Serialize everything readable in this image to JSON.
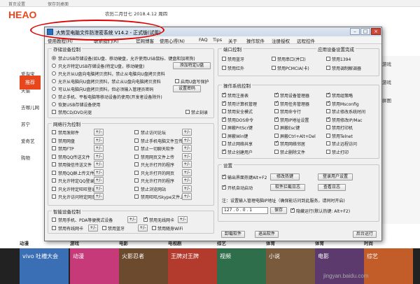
{
  "browser": {
    "tab_home": "首页设置",
    "tab_save": "保存到桌面",
    "logo": "HEAO",
    "date_line": "农历二月廿七  2018.4.12  周四",
    "left_items": [
      "爱淘宝",
      "天猫",
      "去哪儿网",
      "苏宁",
      "爱奇艺",
      "购物"
    ],
    "orange_badge": "推荐",
    "right_items": [
      "游戏",
      "游戏",
      "拼图"
    ],
    "bottom_cats": [
      "动漫",
      "游戏",
      "电影",
      "电视剧",
      "综艺",
      "体育",
      "体育",
      "时尚"
    ],
    "tiles": [
      "vivo 吐槽大会",
      "动漫",
      "火影忍者",
      "王牌对王牌",
      "视频",
      "小说",
      "电影",
      "综艺"
    ],
    "watermark": "jingyan.baidu.com"
  },
  "window": {
    "title": "大势至电脑文件防泄密系统 V14.2 - 正式版(试用)",
    "menu": [
      "使用教程(H)",
      "联系我们(R)",
      "官网博客",
      "使用心得(N)",
      "FAQ",
      "Tips",
      "关于",
      "操作软件",
      "注册授权",
      "远程控件"
    ],
    "storage": {
      "title": "存储设备控制",
      "options": [
        "禁止USB存储设备(如U盘、移动硬盘，允许使用USB鼠标、键盘和加密狗)",
        "只允许特定USB存储设备(特定U盘，移动硬盘)",
        "只允许从U盘向电脑拷贝资料，禁止从电脑向U盘拷贝资料",
        "允许从电脑向U盘拷贝资料，禁止从U盘向电脑拷贝资料",
        "可以从电脑向U盘拷贝资料，但必须输入管理员密码",
        "恢复USB存储设备使用",
        "禁用CD/DVD光驱",
        "禁止手机、平板电脑等移动设备的使用(开发者设备除外)"
      ],
      "btn_add_usb": "添加特定U盘",
      "cb_readonly": "启用U盘写保护",
      "cb_refresh": "禁止刻录",
      "opt_cd_label": "禁止刻录",
      "btn_set_pwd": "设置密码"
    },
    "network": {
      "title": "网络行为控制",
      "left": [
        "禁用发邮件",
        "禁用网盘",
        "禁用FTP",
        "禁用QQ传送文件",
        "禁用微信传送文件",
        "禁用QQ群上传文件",
        "只允许特定QQ登录",
        "只允许特定旺旺登录",
        "只允许访问特定网页"
      ],
      "right": [
        "禁止访问论坛",
        "禁止手机电脑文件互传",
        "禁止一切聊天软件",
        "禁用网页文件上传",
        "只允许打开的程序",
        "只允许打开的网页",
        "只允许打开的程序",
        "禁止浏览网站",
        "禁用旺旺/Skype文件上传"
      ],
      "btn": "+/-"
    },
    "smart": {
      "title": "智能设备控制",
      "items": [
        "禁用手机、PDA等便携式设备",
        "禁用有线网卡",
        "禁用无线网卡",
        "禁用蓝牙",
        "禁用随身WiFi"
      ],
      "btn": "+/-"
    },
    "port": {
      "title": "端口控制",
      "items": [
        "禁用蓝牙",
        "禁用串口(并口)",
        "禁用1394",
        "禁用红外",
        "禁用PCMCIA(卡)",
        "禁用调制解调器"
      ],
      "app_title": "应用设备设置完成"
    },
    "os": {
      "title": "操作系统控制",
      "items": [
        [
          "禁用注册表",
          "禁用设备管理器",
          "禁用组策略"
        ],
        [
          "禁用计算机管理",
          "禁用任务管理器",
          "禁用Msconfig"
        ],
        [
          "禁用安全模式",
          "禁用命令行",
          "禁止修改系统时间"
        ],
        [
          "禁用DOS命令",
          "禁用IP地址设置",
          "禁用修改IP/Mac"
        ],
        [
          "屏蔽PrtScr键",
          "屏蔽Esc键",
          "禁用打印机"
        ],
        [
          "屏蔽Win键",
          "屏蔽Ctrl+Alt+Del",
          "禁用Telnet"
        ],
        [
          "禁止网络共享",
          "禁用网络邻居",
          "禁止远程访问"
        ],
        [
          "禁止创建用户",
          "禁止删除文件",
          "禁止打印"
        ]
      ],
      "checked": [
        [
          true,
          true,
          true
        ],
        [
          true,
          true,
          true
        ],
        [
          false,
          false,
          false
        ],
        [
          true,
          true,
          true
        ],
        [
          false,
          false,
          false
        ],
        [
          false,
          false,
          false
        ],
        [
          false,
          true,
          false
        ],
        [
          true,
          false,
          false
        ]
      ]
    },
    "settings": {
      "title": "设置",
      "hotkey_label": "输出界面热键Alt+F2",
      "autostart_label": "开机自动启动",
      "btn_modify_pwd": "修改热键",
      "btn_tips": "软件拦截日志",
      "btn_login_user": "登录用户设置",
      "btn_view_log": "查看日志",
      "note": "注：设置输入管理电脑IP地址（确保能访问到此服务，请同时开启)",
      "ip_value": "127 . 0 . 0 . 1",
      "btn_save": "保存",
      "hide_label": "隐藏运行(默认热键: Alt+F2)"
    },
    "footer": {
      "btn_uninstall": "卸载软件",
      "btn_exit": "退出软件",
      "btn_background": "后台运行"
    }
  }
}
